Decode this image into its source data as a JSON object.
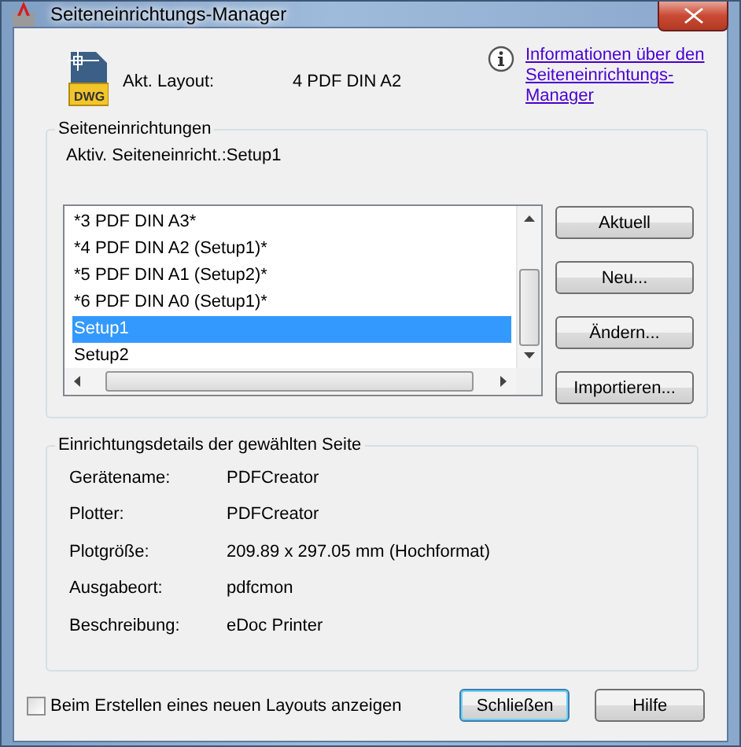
{
  "window": {
    "title": "Seiteneinrichtungs-Manager"
  },
  "file_icon_label": "DWG",
  "current_layout": {
    "label": "Akt. Layout:",
    "value": "4 PDF DIN A2"
  },
  "info_link": "Informationen über den Seiteneinrichtungs-Manager",
  "page_setups": {
    "title": "Seiteneinrichtungen",
    "active_label": "Aktiv. Seiteneinricht.:Setup1",
    "items": [
      {
        "label": "*3 PDF DIN A3*",
        "selected": false
      },
      {
        "label": "*4 PDF DIN A2 (Setup1)*",
        "selected": false
      },
      {
        "label": "*5 PDF DIN A1 (Setup2)*",
        "selected": false
      },
      {
        "label": "*6 PDF DIN A0 (Setup1)*",
        "selected": false
      },
      {
        "label": "Setup1",
        "selected": true
      },
      {
        "label": "Setup2",
        "selected": false
      }
    ],
    "buttons": [
      "Aktuell",
      "Neu...",
      "Ändern...",
      "Importieren..."
    ]
  },
  "details": {
    "title": "Einrichtungsdetails der gewählten Seite",
    "rows": [
      {
        "label": "Gerätename:",
        "value": "PDFCreator"
      },
      {
        "label": "Plotter:",
        "value": "PDFCreator"
      },
      {
        "label": "Plotgröße:",
        "value": "209.89 x 297.05 mm (Hochformat)"
      },
      {
        "label": "Ausgabeort:",
        "value": "pdfcmon"
      },
      {
        "label": "Beschreibung:",
        "value": "eDoc Printer"
      }
    ]
  },
  "show_on_new_layout": {
    "label": "Beim Erstellen eines neuen Layouts anzeigen",
    "checked": false
  },
  "buttons": [
    {
      "label": "Schließen",
      "default": true
    },
    {
      "label": "Hilfe",
      "default": false
    }
  ]
}
